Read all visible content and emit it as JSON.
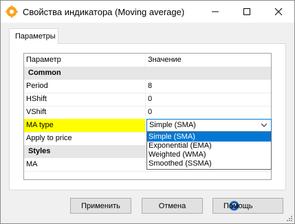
{
  "window": {
    "title": "Свойства индикатора (Moving average)"
  },
  "tabs": [
    {
      "label": "Параметры",
      "active": true
    }
  ],
  "grid": {
    "headers": {
      "name": "Параметр",
      "value": "Значение"
    },
    "rows": [
      {
        "type": "section",
        "name": "Common"
      },
      {
        "type": "param",
        "name": "Period",
        "value": "8"
      },
      {
        "type": "param",
        "name": "HShift",
        "value": "0"
      },
      {
        "type": "param",
        "name": "VShift",
        "value": "0"
      },
      {
        "type": "param",
        "name": "MA type",
        "value": "Simple (SMA)",
        "highlighted": true
      },
      {
        "type": "param",
        "name": "Apply to price",
        "value": ""
      },
      {
        "type": "section",
        "name": "Styles"
      },
      {
        "type": "param",
        "name": "MA",
        "value": ""
      }
    ]
  },
  "ma_type_combo": {
    "selected": "Simple (SMA)",
    "options": [
      "Simple (SMA)",
      "Exponential (EMA)",
      "Weighted (WMA)",
      "Smoothed (SSMA)"
    ]
  },
  "buttons": {
    "apply": "Применить",
    "cancel": "Отмена",
    "help": "Помощь"
  },
  "colors": {
    "highlight": "#ffff00",
    "selection": "#0078d7",
    "section_bg": "#e6e6e6"
  }
}
